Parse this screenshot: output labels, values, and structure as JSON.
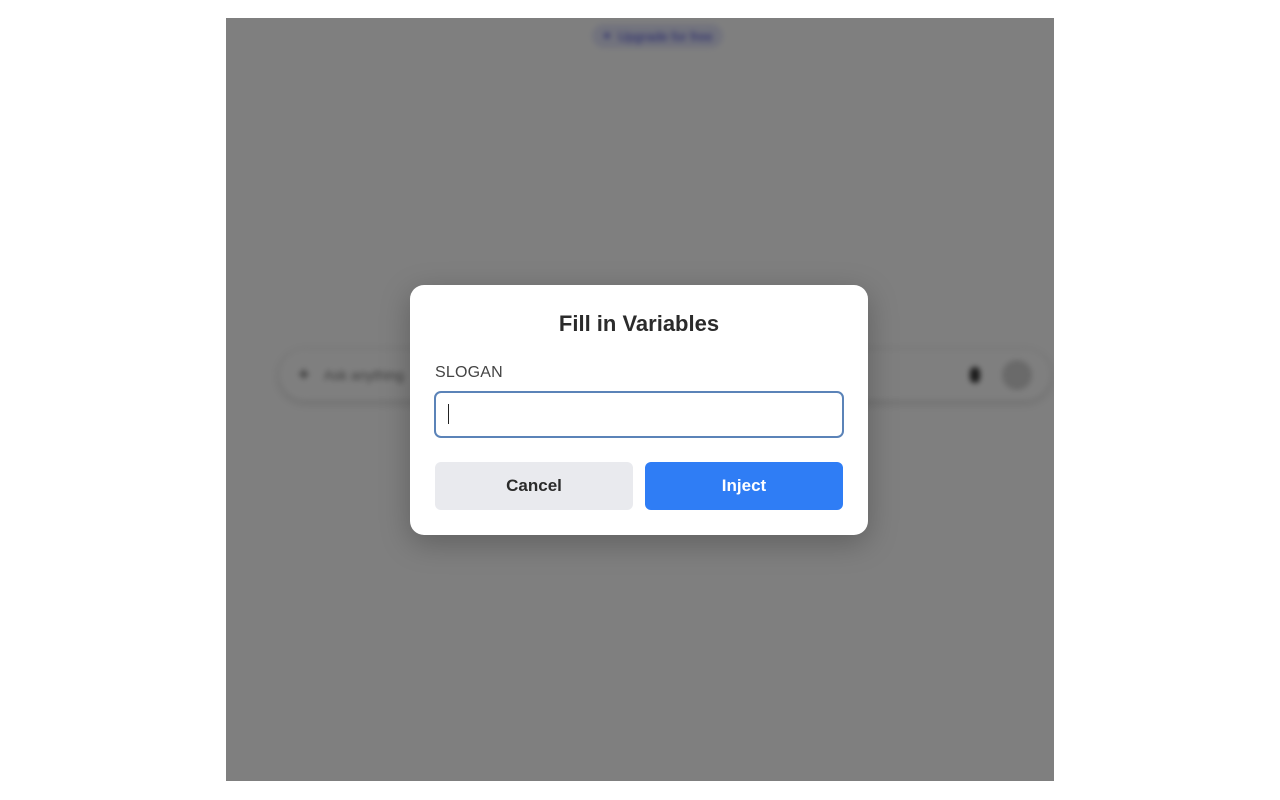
{
  "background": {
    "upgrade_label": "Upgrade for free",
    "chat_placeholder": "Ask anything"
  },
  "dialog": {
    "title": "Fill in Variables",
    "fields": [
      {
        "label": "SLOGAN",
        "value": ""
      }
    ],
    "cancel_label": "Cancel",
    "inject_label": "Inject"
  },
  "colors": {
    "primary_button": "#2f7df5",
    "secondary_button": "#e9eaee",
    "input_focus_border": "#5b83b8",
    "overlay": "rgba(0,0,0,0.5)"
  }
}
